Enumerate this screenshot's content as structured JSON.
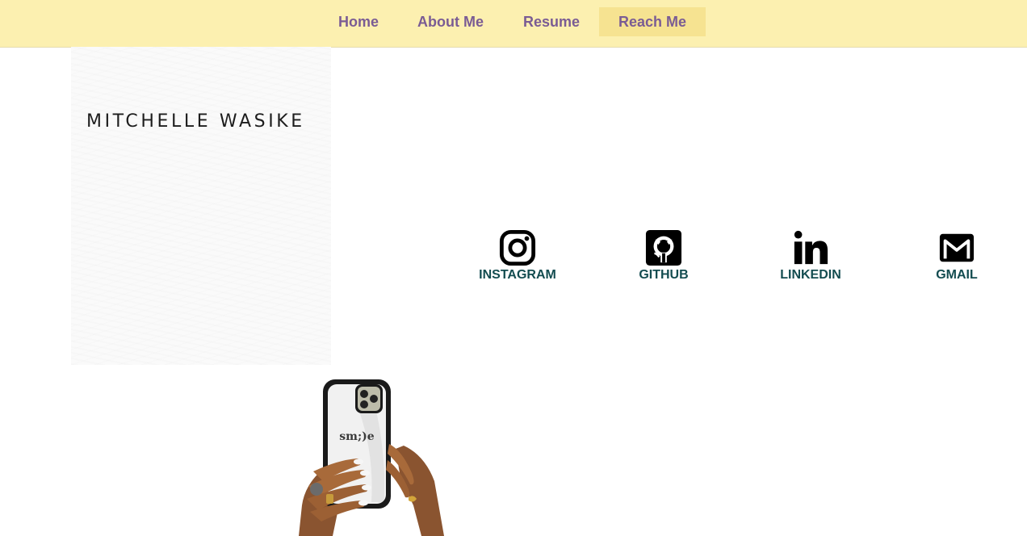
{
  "nav": {
    "items": [
      {
        "label": "Home"
      },
      {
        "label": "About Me"
      },
      {
        "label": "Resume"
      },
      {
        "label": "Reach Me",
        "active": true
      }
    ]
  },
  "brand": {
    "logo_text": "MITCHELLE WASIKE"
  },
  "socials": [
    {
      "label": "INSTAGRAM",
      "icon": "instagram-icon"
    },
    {
      "label": "GITHUB",
      "icon": "github-icon"
    },
    {
      "label": "LINKEDIN",
      "icon": "linkedin-icon"
    },
    {
      "label": "GMAIL",
      "icon": "gmail-icon"
    }
  ],
  "illustration": {
    "phone_case_text": "sm;)e"
  },
  "colors": {
    "nav_background": "#fcf0b0",
    "nav_active_background": "#f6e391",
    "nav_text": "#7a5c94",
    "social_label": "#134c50"
  }
}
